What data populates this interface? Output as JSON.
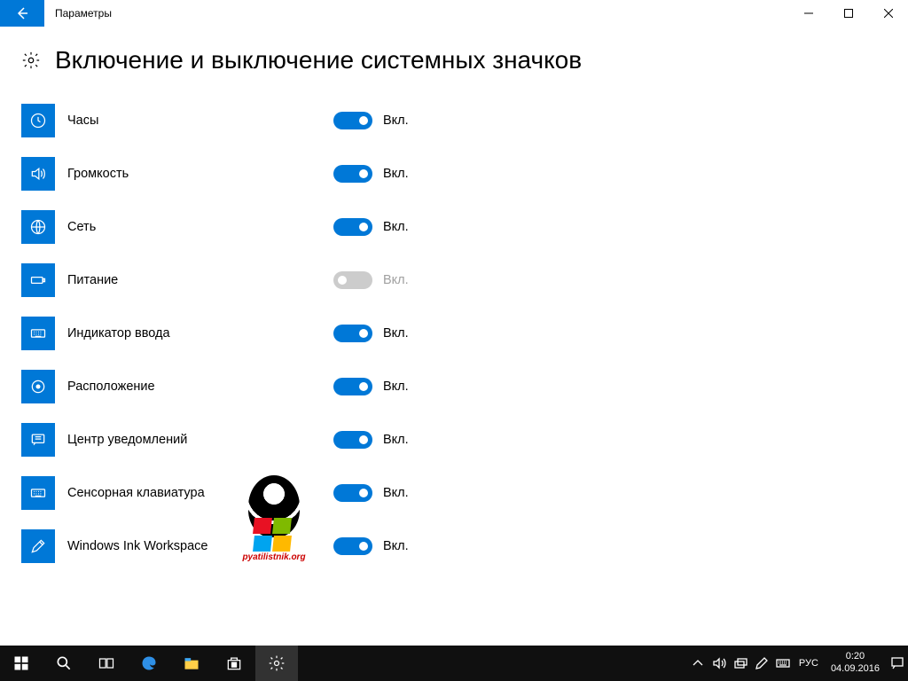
{
  "header": {
    "app_title": "Параметры"
  },
  "page": {
    "title": "Включение и выключение системных значков"
  },
  "states": {
    "on": "Вкл.",
    "off": "Вкл."
  },
  "items": [
    {
      "label": "Часы",
      "state": "Вкл.",
      "enabled": true
    },
    {
      "label": "Громкость",
      "state": "Вкл.",
      "enabled": true
    },
    {
      "label": "Сеть",
      "state": "Вкл.",
      "enabled": true
    },
    {
      "label": "Питание",
      "state": "Вкл.",
      "enabled": false
    },
    {
      "label": "Индикатор ввода",
      "state": "Вкл.",
      "enabled": true
    },
    {
      "label": "Расположение",
      "state": "Вкл.",
      "enabled": true
    },
    {
      "label": "Центр уведомлений",
      "state": "Вкл.",
      "enabled": true
    },
    {
      "label": "Сенсорная клавиатура",
      "state": "Вкл.",
      "enabled": true
    },
    {
      "label": "Windows Ink Workspace",
      "state": "Вкл.",
      "enabled": true
    }
  ],
  "watermark": {
    "text": "pyatilistnik.org"
  },
  "taskbar": {
    "lang": "РУС",
    "time": "0:20",
    "date": "04.09.2016"
  }
}
